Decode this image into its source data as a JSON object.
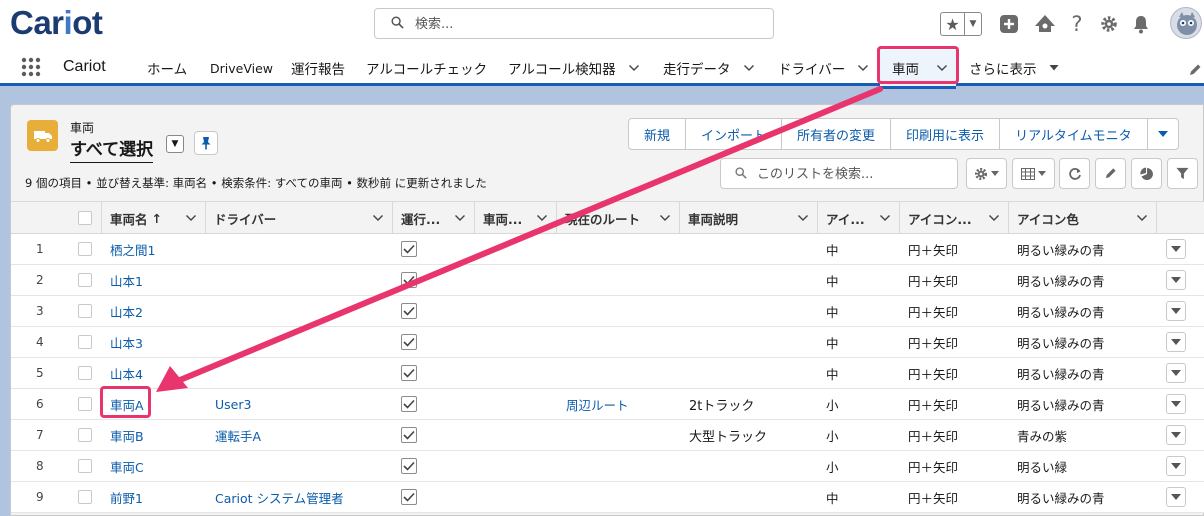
{
  "header": {
    "logo_prefix": "Car",
    "logo_o": "i",
    "logo_suffix": "ot",
    "search_placeholder": "検索..."
  },
  "nav": {
    "app_name": "Cariot",
    "items": [
      {
        "label": "ホーム",
        "dropdown": false
      },
      {
        "label": "DriveView",
        "dropdown": false
      },
      {
        "label": "運行報告",
        "dropdown": false
      },
      {
        "label": "アルコールチェック",
        "dropdown": false
      },
      {
        "label": "アルコール検知器",
        "dropdown": true
      },
      {
        "label": "走行データ",
        "dropdown": true
      },
      {
        "label": "ドライバー",
        "dropdown": true
      },
      {
        "label": "車両",
        "dropdown": true,
        "active": true
      },
      {
        "label": "さらに表示",
        "dropdown": true
      }
    ]
  },
  "list": {
    "object_label": "車両",
    "view_name": "すべて選択",
    "meta": "9 個の項目 • 並び替え基準: 車両名 • 検索条件: すべての車両 • 数秒前 に更新されました",
    "search_placeholder": "このリストを検索...",
    "actions": [
      "新規",
      "インポート",
      "所有者の変更",
      "印刷用に表示",
      "リアルタイムモニタ"
    ]
  },
  "table": {
    "columns": [
      "車両名",
      "ドライバー",
      "運行...",
      "車両...",
      "現在のルート",
      "車両説明",
      "アイ...",
      "アイコン...",
      "アイコン色"
    ],
    "sort_indicator": "↑",
    "rows": [
      {
        "num": "1",
        "name": "栖之間1",
        "driver": "",
        "active": true,
        "route": "",
        "desc": "",
        "size": "中",
        "shape": "円＋矢印",
        "color": "明るい緑みの青"
      },
      {
        "num": "2",
        "name": "山本1",
        "driver": "",
        "active": true,
        "route": "",
        "desc": "",
        "size": "中",
        "shape": "円＋矢印",
        "color": "明るい緑みの青"
      },
      {
        "num": "3",
        "name": "山本2",
        "driver": "",
        "active": true,
        "route": "",
        "desc": "",
        "size": "中",
        "shape": "円＋矢印",
        "color": "明るい緑みの青"
      },
      {
        "num": "4",
        "name": "山本3",
        "driver": "",
        "active": true,
        "route": "",
        "desc": "",
        "size": "中",
        "shape": "円＋矢印",
        "color": "明るい緑みの青"
      },
      {
        "num": "5",
        "name": "山本4",
        "driver": "",
        "active": true,
        "route": "",
        "desc": "",
        "size": "中",
        "shape": "円＋矢印",
        "color": "明るい緑みの青"
      },
      {
        "num": "6",
        "name": "車両A",
        "driver": "User3",
        "active": true,
        "route": "周辺ルート",
        "desc": "2tトラック",
        "size": "小",
        "shape": "円＋矢印",
        "color": "明るい緑みの青"
      },
      {
        "num": "7",
        "name": "車両B",
        "driver": "運転手A",
        "active": true,
        "route": "",
        "desc": "大型トラック",
        "size": "小",
        "shape": "円＋矢印",
        "color": "青みの紫"
      },
      {
        "num": "8",
        "name": "車両C",
        "driver": "",
        "active": true,
        "route": "",
        "desc": "",
        "size": "小",
        "shape": "円＋矢印",
        "color": "明るい緑"
      },
      {
        "num": "9",
        "name": "前野1",
        "driver": "Cariot システム管理者",
        "active": true,
        "route": "",
        "desc": "",
        "size": "中",
        "shape": "円＋矢印",
        "color": "明るい緑みの青"
      }
    ]
  },
  "colors": {
    "brand_dark": "#1a3c72",
    "link": "#0b5cab",
    "highlight": "#e8356d",
    "object_icon": "#e8ae3a",
    "nav_accent": "#1a5bb5"
  }
}
